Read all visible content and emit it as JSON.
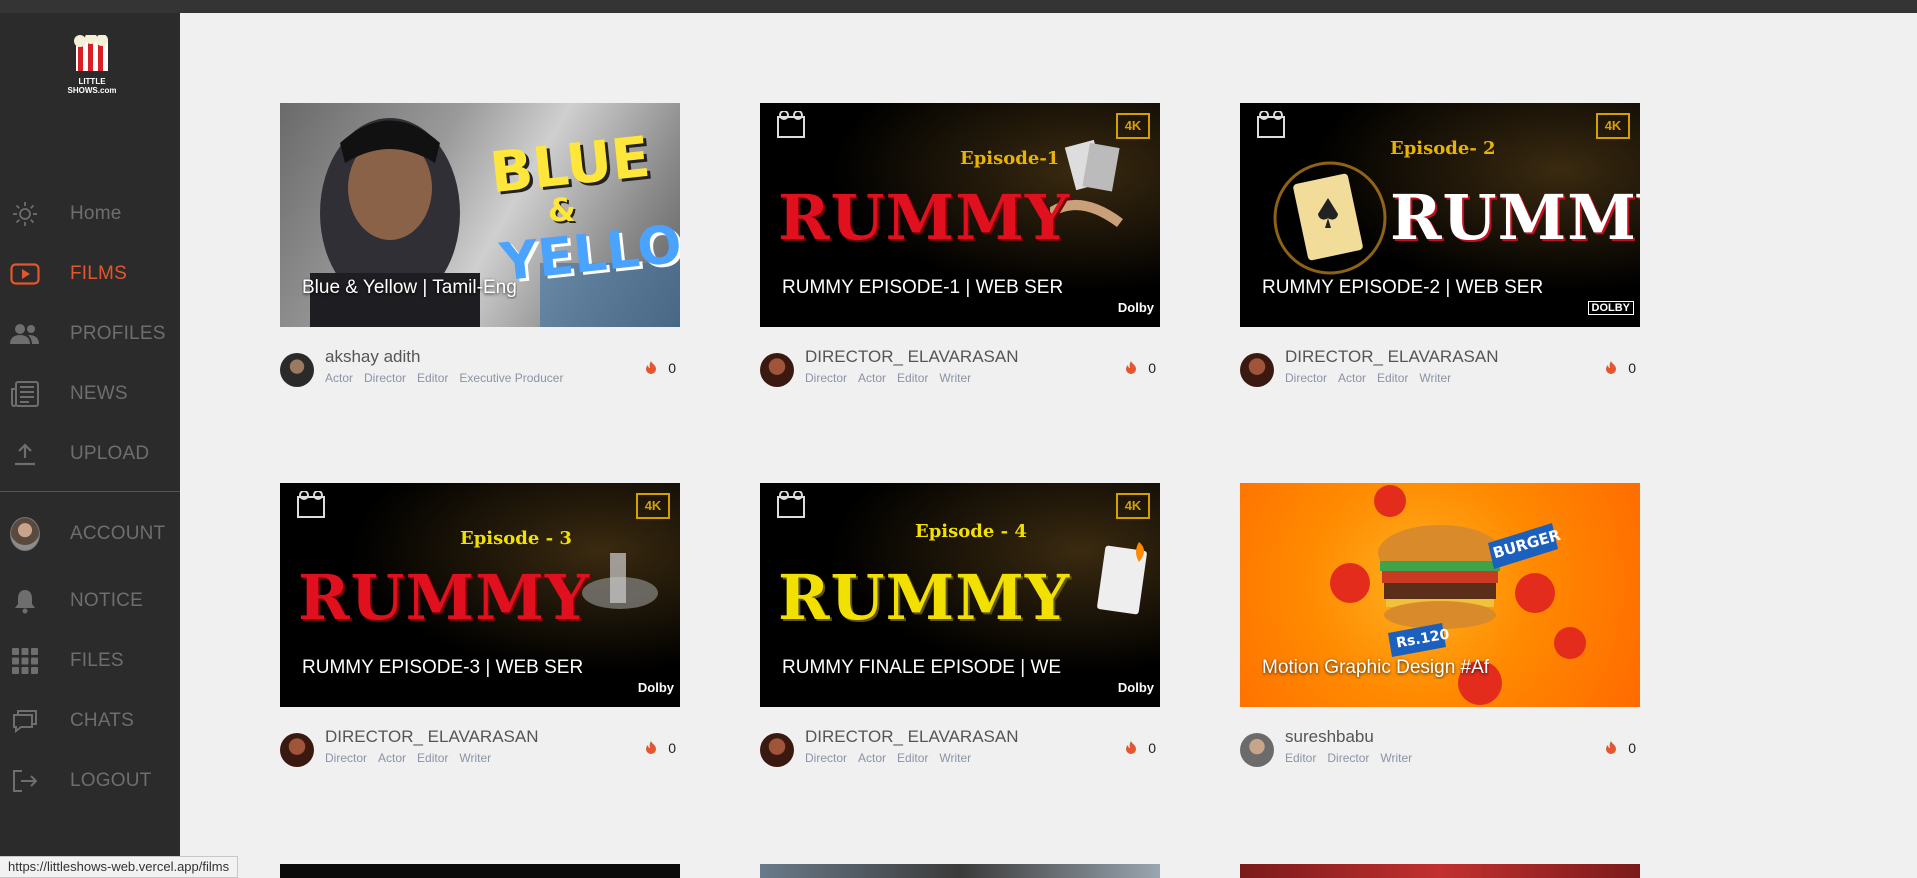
{
  "logo_text": "LITTLE SHOWS.com",
  "colors": {
    "sidebar_bg": "#2b2b2b",
    "accent": "#e4572e",
    "page_bg": "#f0f0f0"
  },
  "nav": {
    "home": {
      "label": "Home",
      "icon": "sun-icon"
    },
    "films": {
      "label": "FILMS",
      "icon": "play-icon"
    },
    "profiles": {
      "label": "PROFILES",
      "icon": "users-icon"
    },
    "news": {
      "label": "NEWS",
      "icon": "newspaper-icon"
    },
    "upload": {
      "label": "UPLOAD",
      "icon": "upload-icon"
    },
    "account": {
      "label": "ACCOUNT",
      "icon": "avatar"
    },
    "notice": {
      "label": "NOTICE",
      "icon": "bell-icon"
    },
    "files": {
      "label": "FILES",
      "icon": "grid-icon"
    },
    "chats": {
      "label": "CHATS",
      "icon": "chat-icon"
    },
    "logout": {
      "label": "LOGOUT",
      "icon": "logout-icon"
    }
  },
  "films": [
    {
      "title": "Blue & Yellow | Tamil-Eng",
      "author": "akshay adith",
      "roles": [
        "Actor",
        "Director",
        "Editor",
        "Executive Producer"
      ],
      "likes": "0"
    },
    {
      "title": "RUMMY EPISODE-1 | WEB SER",
      "author": "DIRECTOR_ ELAVARASAN",
      "roles": [
        "Director",
        "Actor",
        "Editor",
        "Writer"
      ],
      "likes": "0"
    },
    {
      "title": "RUMMY EPISODE-2 | WEB SER",
      "author": "DIRECTOR_ ELAVARASAN",
      "roles": [
        "Director",
        "Actor",
        "Editor",
        "Writer"
      ],
      "likes": "0"
    },
    {
      "title": "RUMMY EPISODE-3 | WEB SER",
      "author": "DIRECTOR_ ELAVARASAN",
      "roles": [
        "Director",
        "Actor",
        "Editor",
        "Writer"
      ],
      "likes": "0"
    },
    {
      "title": "RUMMY FINALE EPISODE | WE",
      "author": "DIRECTOR_ ELAVARASAN",
      "roles": [
        "Director",
        "Actor",
        "Editor",
        "Writer"
      ],
      "likes": "0"
    },
    {
      "title": "Motion Graphic Design #Af",
      "author": "sureshbabu",
      "roles": [
        "Editor",
        "Director",
        "Writer"
      ],
      "likes": "0"
    }
  ],
  "art": {
    "blue_word1": "BLUE",
    "blue_amp": "&",
    "blue_word2": "YELLOW",
    "rummy_word": "RUMMY",
    "ep1": "Episode-1",
    "ep2": "Episode- 2",
    "ep3": "Episode - 3",
    "ep4": "Episode - 4",
    "badge_4k": "4K",
    "dolby": "Dolby",
    "dolby_caps": "DOLBY",
    "burger_tag": "BURGER",
    "price_tag": "Rs.120"
  },
  "status_url": "https://littleshows-web.vercel.app/films"
}
